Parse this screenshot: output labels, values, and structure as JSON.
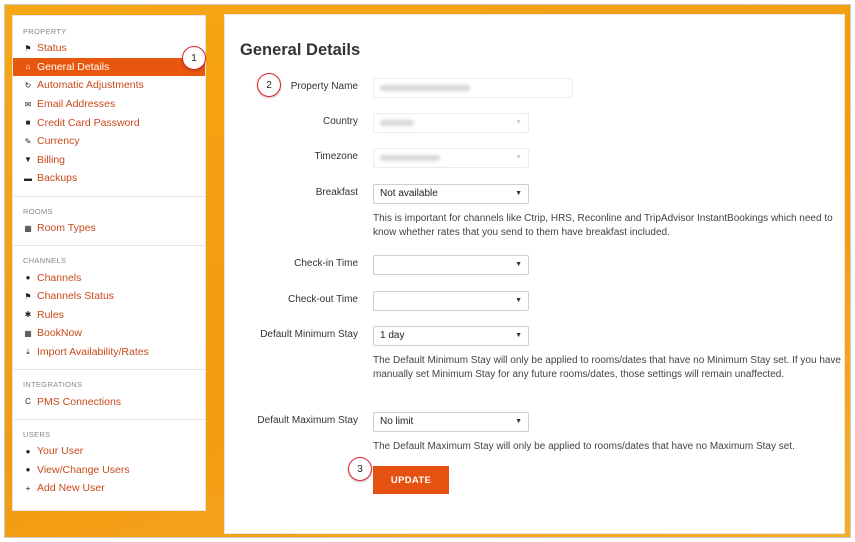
{
  "sidebar": {
    "sections": [
      {
        "title": "PROPERTY",
        "items": [
          {
            "label": "Status",
            "icon": "flag-icon"
          },
          {
            "label": "General Details",
            "icon": "home-icon",
            "active": true
          },
          {
            "label": "Automatic Adjustments",
            "icon": "refresh-icon"
          },
          {
            "label": "Email Addresses",
            "icon": "envelope-icon"
          },
          {
            "label": "Credit Card Password",
            "icon": "lock-icon"
          },
          {
            "label": "Currency",
            "icon": "edit-icon"
          },
          {
            "label": "Billing",
            "icon": "cart-icon"
          },
          {
            "label": "Backups",
            "icon": "drive-icon"
          }
        ]
      },
      {
        "title": "ROOMS",
        "items": [
          {
            "label": "Room Types",
            "icon": "grid-icon"
          }
        ]
      },
      {
        "title": "CHANNELS",
        "items": [
          {
            "label": "Channels",
            "icon": "globe-icon"
          },
          {
            "label": "Channels Status",
            "icon": "flag-icon"
          },
          {
            "label": "Rules",
            "icon": "gear-icon"
          },
          {
            "label": "BookNow",
            "icon": "grid-icon"
          },
          {
            "label": "Import Availability/Rates",
            "icon": "download-icon"
          }
        ]
      },
      {
        "title": "INTEGRATIONS",
        "items": [
          {
            "label": "PMS Connections",
            "icon": "pms-icon"
          }
        ]
      },
      {
        "title": "USERS",
        "items": [
          {
            "label": "Your User",
            "icon": "user-icon"
          },
          {
            "label": "View/Change Users",
            "icon": "user-icon"
          },
          {
            "label": "Add New User",
            "icon": "plus-icon"
          }
        ]
      }
    ]
  },
  "badges": {
    "b1": "1",
    "b2": "2",
    "b3": "3"
  },
  "main": {
    "title": "General Details",
    "fields": {
      "property_name": {
        "label": "Property Name"
      },
      "country": {
        "label": "Country"
      },
      "timezone": {
        "label": "Timezone"
      },
      "breakfast": {
        "label": "Breakfast",
        "value": "Not available",
        "help": "This is important for channels like Ctrip, HRS, Reconline and TripAdvisor InstantBookings which need to know whether rates that you send to them have breakfast included."
      },
      "checkin": {
        "label": "Check-in Time",
        "value": ""
      },
      "checkout": {
        "label": "Check-out Time",
        "value": ""
      },
      "min_stay": {
        "label": "Default Minimum Stay",
        "value": "1 day",
        "help": "The Default Minimum Stay will only be applied to rooms/dates that have no Minimum Stay set. If you have manually set Minimum Stay for any future rooms/dates, those settings will remain unaffected."
      },
      "max_stay": {
        "label": "Default Maximum Stay",
        "value": "No limit",
        "help": "The Default Maximum Stay will only be applied to rooms/dates that have no Maximum Stay set."
      }
    },
    "update_label": "UPDATE"
  },
  "colors": {
    "accent": "#e8570e",
    "background": "#f6a312",
    "link": "#c74a1b",
    "badge_border": "#e0212b"
  }
}
